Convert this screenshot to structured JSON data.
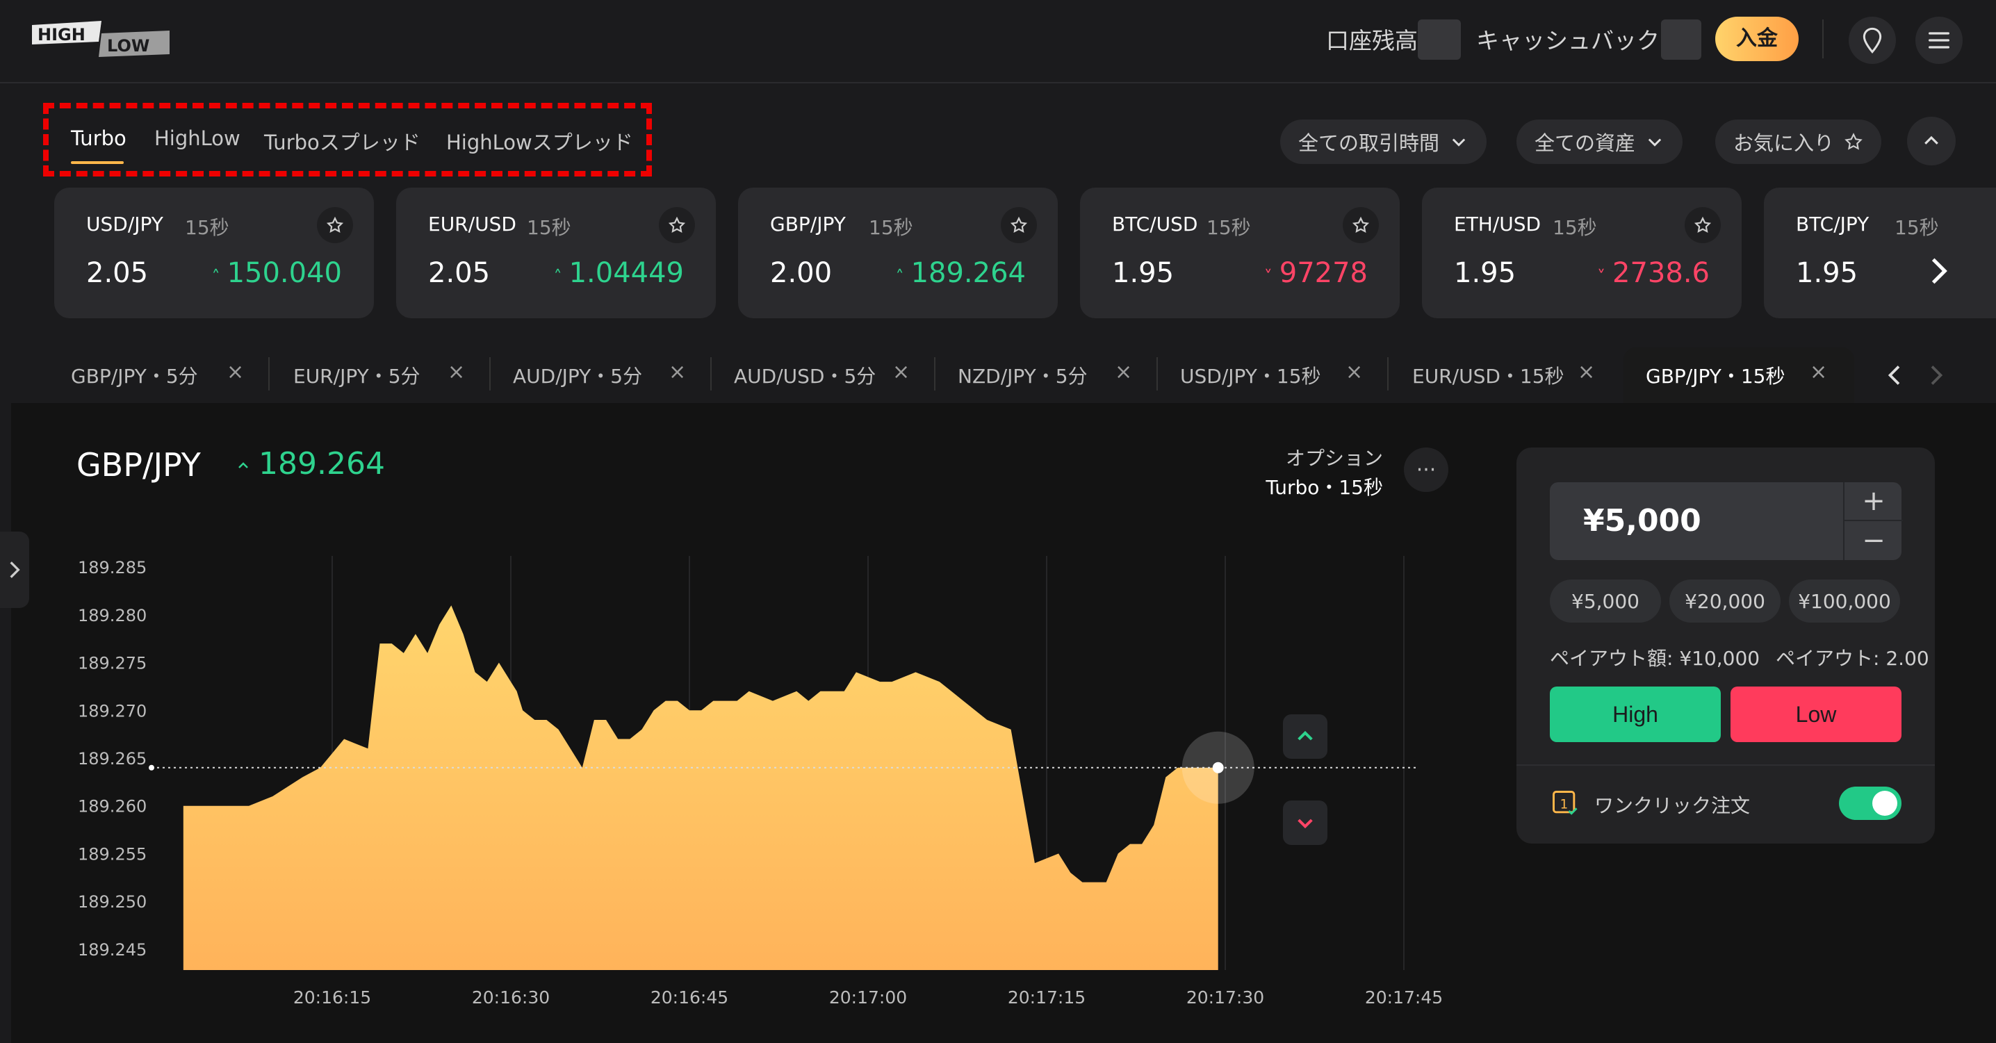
{
  "header": {
    "logo_top": "HIGH",
    "logo_bottom": "LOW",
    "balance_label": "口座残高",
    "cashback_label": "キャッシュバック",
    "deposit_label": "入金"
  },
  "option_tabs": [
    {
      "label": "Turbo",
      "active": true
    },
    {
      "label": "HighLow",
      "active": false
    },
    {
      "label": "Turboスプレッド",
      "active": false
    },
    {
      "label": "HighLowスプレッド",
      "active": false
    }
  ],
  "filters": {
    "time": "全ての取引時間",
    "assets": "全ての資産",
    "favorites": "お気に入り"
  },
  "asset_cards": [
    {
      "pair": "USD/JPY",
      "duration": "15秒",
      "payout": "2.05",
      "price": "150.040",
      "trend": "up"
    },
    {
      "pair": "EUR/USD",
      "duration": "15秒",
      "payout": "2.05",
      "price": "1.04449",
      "trend": "up"
    },
    {
      "pair": "GBP/JPY",
      "duration": "15秒",
      "payout": "2.00",
      "price": "189.264",
      "trend": "up"
    },
    {
      "pair": "BTC/USD",
      "duration": "15秒",
      "payout": "1.95",
      "price": "97278",
      "trend": "down"
    },
    {
      "pair": "ETH/USD",
      "duration": "15秒",
      "payout": "1.95",
      "price": "2738.6",
      "trend": "down"
    },
    {
      "pair": "BTC/JPY",
      "duration": "15秒",
      "payout": "1.95",
      "price": "",
      "trend": "up"
    }
  ],
  "chart_tabs": [
    {
      "label": "GBP/JPY・5分",
      "active": false
    },
    {
      "label": "EUR/JPY・5分",
      "active": false
    },
    {
      "label": "AUD/JPY・5分",
      "active": false
    },
    {
      "label": "AUD/USD・5分",
      "active": false
    },
    {
      "label": "NZD/JPY・5分",
      "active": false
    },
    {
      "label": "USD/JPY・15秒",
      "active": false
    },
    {
      "label": "EUR/USD・15秒",
      "active": false
    },
    {
      "label": "GBP/JPY・15秒",
      "active": true
    }
  ],
  "main": {
    "asset": "GBP/JPY",
    "price": "189.264",
    "option_label": "オプション",
    "option_value": "Turbo・15秒"
  },
  "chart_data": {
    "type": "area",
    "title": "",
    "xlabel": "",
    "ylabel": "",
    "ylim": [
      189.2428,
      189.2872
    ],
    "y_ticks": [
      "189.285",
      "189.280",
      "189.275",
      "189.270",
      "189.265",
      "189.260",
      "189.255",
      "189.250",
      "189.245"
    ],
    "x_ticks": [
      "20:16:15",
      "20:16:30",
      "20:16:45",
      "20:17:00",
      "20:17:15",
      "20:17:30",
      "20:17:45"
    ],
    "x_tick_seconds": [
      15,
      30,
      45,
      60,
      75,
      90,
      105
    ],
    "strike_price": 189.264,
    "series": [
      {
        "x": [
          2.5,
          5,
          8,
          10,
          12.5,
          14,
          16,
          18,
          19,
          20,
          21,
          22,
          22.5,
          23,
          24,
          25,
          26,
          27,
          28,
          29,
          30,
          30.5,
          31,
          32,
          33,
          34,
          35,
          36,
          37,
          38,
          39,
          40,
          41,
          42,
          43,
          44,
          45,
          46,
          47,
          48,
          49,
          50,
          52,
          54,
          55,
          56,
          58,
          59,
          61,
          62,
          64,
          66,
          67,
          68,
          70,
          72,
          74,
          76,
          77,
          78,
          80,
          81,
          82,
          83,
          84,
          85,
          86,
          87,
          87.8,
          88.2,
          88.8,
          89.4
        ],
        "values": [
          189.26,
          189.26,
          189.26,
          189.261,
          189.263,
          189.264,
          189.267,
          189.266,
          189.277,
          189.277,
          189.276,
          189.278,
          189.277,
          189.276,
          189.279,
          189.281,
          189.278,
          189.274,
          189.273,
          189.275,
          189.273,
          189.272,
          189.27,
          189.269,
          189.269,
          189.268,
          189.266,
          189.264,
          189.269,
          189.269,
          189.267,
          189.267,
          189.268,
          189.27,
          189.271,
          189.271,
          189.27,
          189.27,
          189.271,
          189.271,
          189.271,
          189.272,
          189.271,
          189.272,
          189.271,
          189.272,
          189.272,
          189.274,
          189.273,
          189.273,
          189.274,
          189.273,
          189.272,
          189.271,
          189.269,
          189.268,
          189.254,
          189.255,
          189.253,
          189.252,
          189.252,
          189.255,
          189.256,
          189.256,
          189.258,
          189.263,
          189.264,
          189.264,
          189.264,
          189.264,
          189.264,
          189.264
        ]
      }
    ]
  },
  "trade_panel": {
    "amount": "¥5,000",
    "plus": "+",
    "minus": "−",
    "presets": [
      "¥5,000",
      "¥20,000",
      "¥100,000"
    ],
    "payout_amount": "ペイアウト額: ¥10,000",
    "payout_rate": "ペイアウト: 2.00",
    "high_label": "High",
    "low_label": "Low",
    "one_click_label": "ワンクリック注文",
    "one_click_on": true
  },
  "colors": {
    "up": "#2ed38e",
    "down": "#ff4466",
    "accent": "#ffb74a",
    "high_button": "#22c987",
    "low_button": "#ff3b5c",
    "area_top": "#ffd56d",
    "area_bottom": "#ffb35a"
  }
}
